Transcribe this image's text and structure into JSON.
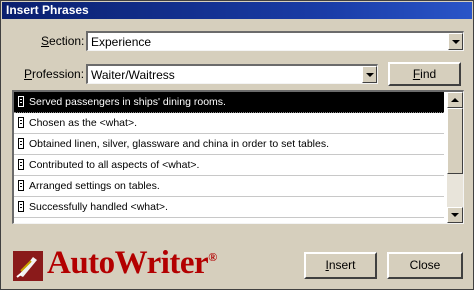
{
  "window": {
    "title": "Insert Phrases"
  },
  "section": {
    "label_pre": "",
    "label_mnemonic": "S",
    "label_post": "ection:",
    "value": "Experience"
  },
  "profession": {
    "label_pre": "",
    "label_mnemonic": "P",
    "label_post": "rofession:",
    "value": "Waiter/Waitress"
  },
  "find_button": {
    "pre": "",
    "mnemonic": "F",
    "post": "ind"
  },
  "phrases": [
    {
      "text": "Served passengers in ships' dining rooms.",
      "selected": true
    },
    {
      "text": "Chosen as the <what>.",
      "selected": false
    },
    {
      "text": "Obtained linen, silver, glassware and china in order to set tables.",
      "selected": false
    },
    {
      "text": "Contributed to all aspects of <what>.",
      "selected": false
    },
    {
      "text": "Arranged settings on tables.",
      "selected": false
    },
    {
      "text": "Successfully handled <what>.",
      "selected": false
    }
  ],
  "logo": {
    "name": "AutoWriter",
    "mark": "®"
  },
  "insert_button": {
    "pre": "",
    "mnemonic": "I",
    "post": "nsert"
  },
  "close_button": {
    "label": "Close"
  },
  "icons": {
    "logo": "quill-logo-icon",
    "row": "document-icon"
  },
  "colors": {
    "title_bar": "#0a1f6e",
    "logo_text": "#b30000",
    "window_bg": "#d6cfbd"
  }
}
